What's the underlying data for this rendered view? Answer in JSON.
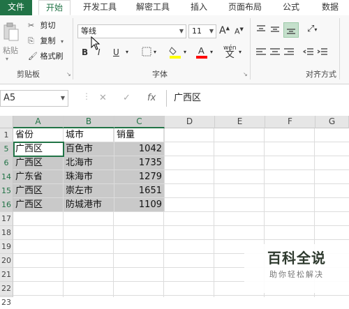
{
  "tabs": [
    "文件",
    "开始",
    "开发工具",
    "解密工具",
    "插入",
    "页面布局",
    "公式",
    "数据"
  ],
  "active_tab": "开始",
  "clipboard": {
    "paste_label": "粘贴",
    "cut_label": "剪切",
    "copy_label": "复制",
    "format_painter_label": "格式刷",
    "group_label": "剪贴板"
  },
  "font": {
    "font_name": "等线",
    "font_size": "11",
    "group_label": "字体",
    "bold": "B",
    "italic": "I",
    "underline": "U",
    "grow": "A",
    "shrink": "A",
    "phonetic": "wén",
    "colors": {
      "fill": "#ffff00",
      "font": "#ff0000"
    }
  },
  "alignment": {
    "group_label": "对齐方式"
  },
  "formula_bar": {
    "name_box": "A5",
    "cancel": "✕",
    "enter": "✓",
    "fx": "fx",
    "value": "广西区"
  },
  "sheet": {
    "columns": [
      "A",
      "B",
      "C",
      "D",
      "E",
      "F",
      "G"
    ],
    "row_numbers": [
      "1",
      "5",
      "6",
      "14",
      "15",
      "16",
      "17",
      "18",
      "19",
      "20",
      "21",
      "22",
      "23"
    ],
    "header_row": [
      "省份",
      "城市",
      "销量"
    ],
    "data_rows": [
      [
        "广西区",
        "百色市",
        "1042"
      ],
      [
        "广西区",
        "北海市",
        "1735"
      ],
      [
        "广东省",
        "珠海市",
        "1279"
      ],
      [
        "广西区",
        "崇左市",
        "1651"
      ],
      [
        "广西区",
        "防城港市",
        "1109"
      ]
    ]
  },
  "watermark": {
    "title": "百科全说",
    "subtitle": "助你轻松解决"
  },
  "colors": {
    "accent": "#217346",
    "selection": "#c9c9c9"
  }
}
